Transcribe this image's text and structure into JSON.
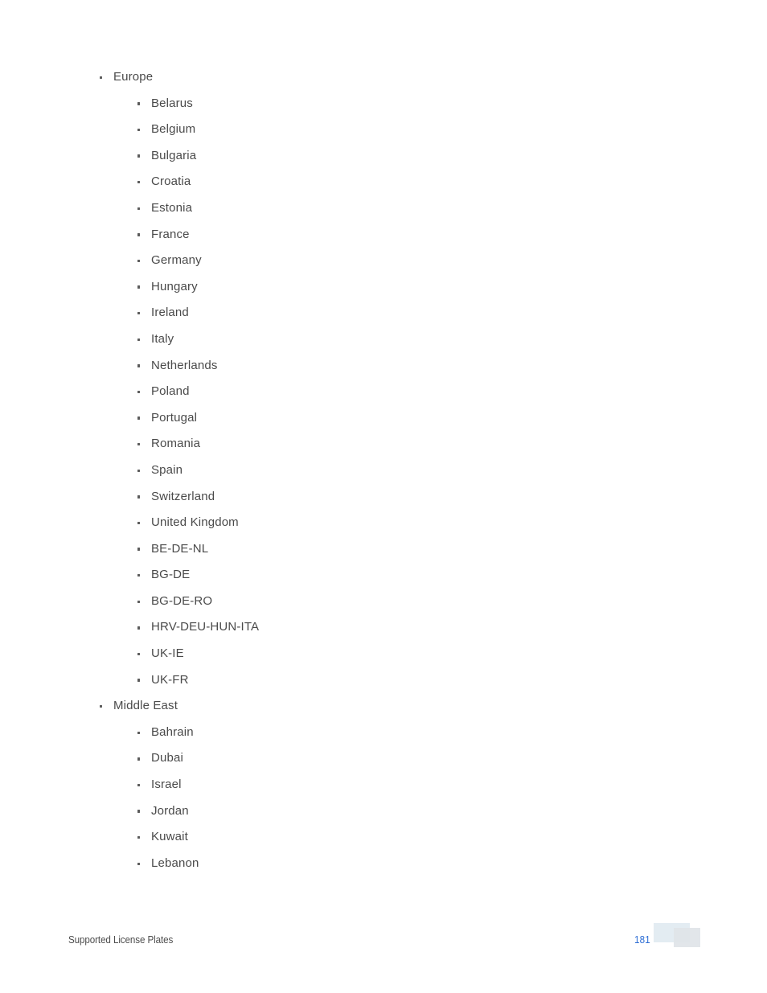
{
  "document": {
    "sections": [
      {
        "label": "Europe",
        "children": [
          "Belarus",
          "Belgium",
          "Bulgaria",
          "Croatia",
          "Estonia",
          "France",
          "Germany",
          "Hungary",
          "Ireland",
          "Italy",
          "Netherlands",
          "Poland",
          "Portugal",
          "Romania",
          "Spain",
          "Switzerland",
          "United Kingdom",
          "BE-DE-NL",
          "BG-DE",
          "BG-DE-RO",
          "HRV-DEU-HUN-ITA",
          "UK-IE",
          "UK-FR"
        ]
      },
      {
        "label": "Middle East",
        "children": [
          "Bahrain",
          "Dubai",
          "Israel",
          "Jordan",
          "Kuwait",
          "Lebanon"
        ]
      }
    ]
  },
  "footer": {
    "title": "Supported License Plates",
    "page_number": "181",
    "logo": "redacted-logo-mark"
  },
  "colors": {
    "text": "#4a4a4a",
    "page_number": "#2b6cd4",
    "bullet": "#5c5c5c",
    "logo_rect_a": "#e3ecf2",
    "logo_rect_b": "#dfe4e8",
    "background": "#ffffff"
  }
}
